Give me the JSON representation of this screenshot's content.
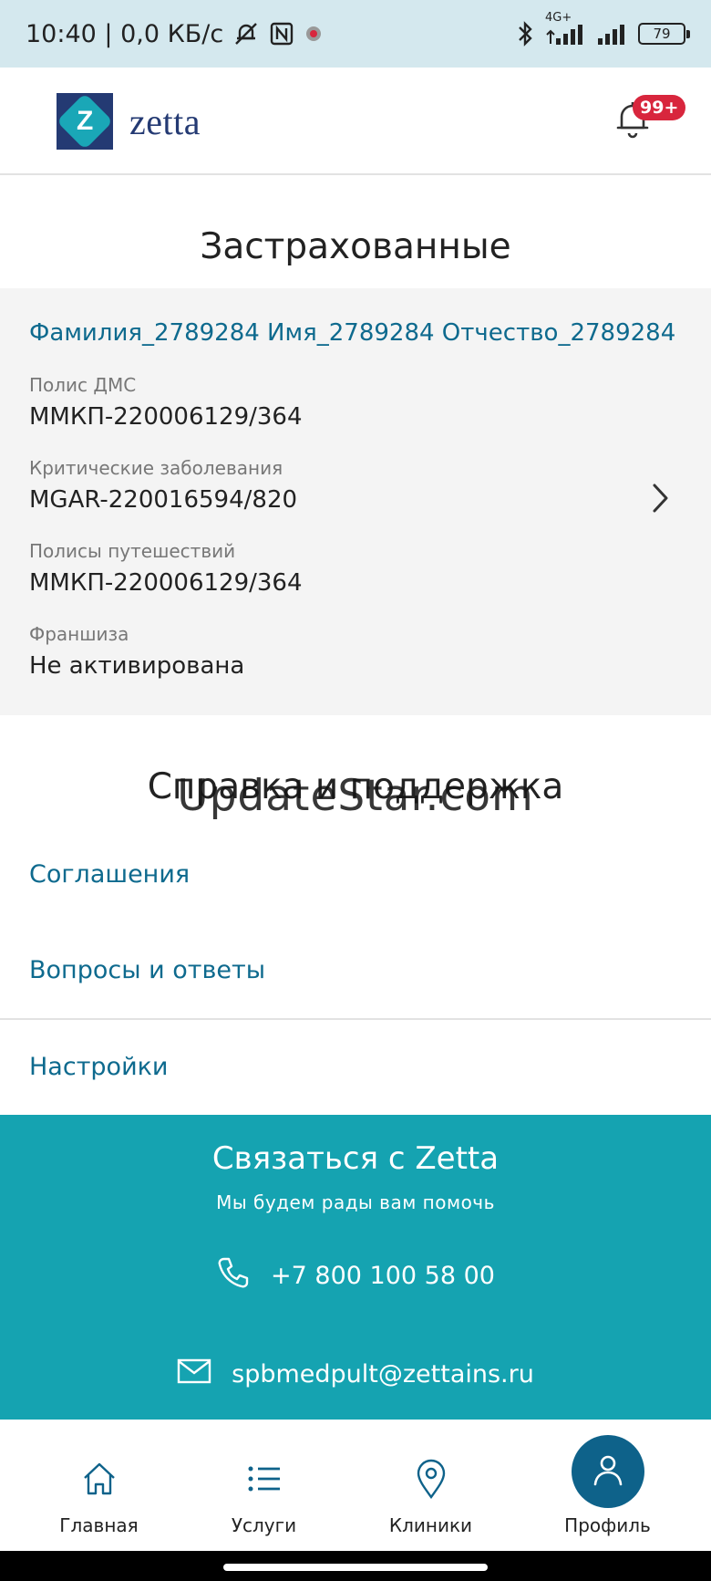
{
  "status_bar": {
    "time_text": "10:40 | 0,0 КБ/с",
    "network_label": "4G+",
    "battery_level": "79"
  },
  "header": {
    "logo_letter": "Z",
    "logo_text": "zetta",
    "notifications_badge": "99+"
  },
  "insured": {
    "section_title": "Застрахованные",
    "person_name": "Фамилия_2789284 Имя_2789284 Отчество_2789284",
    "fields": [
      {
        "label": "Полис ДМС",
        "value": "ММКП-220006129/364"
      },
      {
        "label": "Критические заболевания",
        "value": "MGAR-220016594/820"
      },
      {
        "label": "Полисы путешествий",
        "value": "ММКП-220006129/364"
      },
      {
        "label": "Франшиза",
        "value": "Не активирована"
      }
    ]
  },
  "support": {
    "section_title": "Справка и поддержка",
    "watermark": "UpdateStar.com",
    "links": [
      {
        "label": "Соглашения"
      },
      {
        "label": "Вопросы и ответы"
      },
      {
        "label": "Настройки"
      }
    ]
  },
  "contact": {
    "title": "Связаться с Zetta",
    "subtitle": "Мы будем рады вам помочь",
    "phone": "+7 800 100 58 00",
    "email": "spbmedpult@zettains.ru"
  },
  "navigation": {
    "items": [
      {
        "label": "Главная",
        "icon": "home-icon"
      },
      {
        "label": "Услуги",
        "icon": "list-icon"
      },
      {
        "label": "Клиники",
        "icon": "location-pin-icon"
      },
      {
        "label": "Профиль",
        "icon": "person-icon",
        "active": true
      }
    ]
  },
  "colors": {
    "accent": "#15a3b1",
    "link": "#0e6a8e",
    "active_nav": "#0e628a",
    "badge": "#d8263d",
    "brand_dark": "#243a73"
  }
}
